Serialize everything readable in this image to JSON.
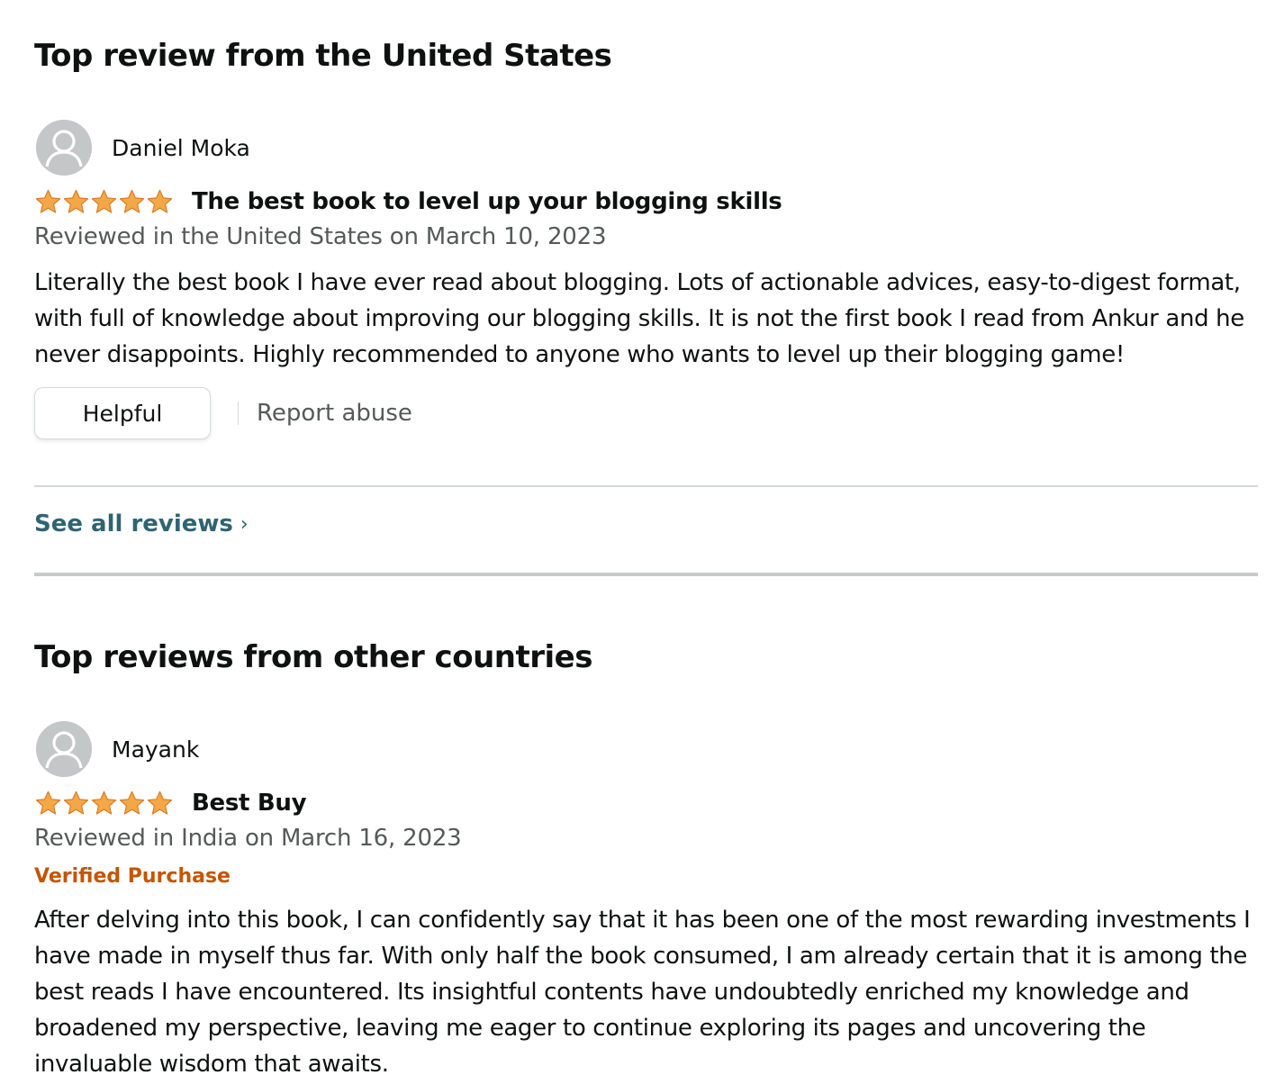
{
  "us_section": {
    "title": "Top review from the United States",
    "review": {
      "reviewer": "Daniel Moka",
      "rating": 5,
      "rating_max": 5,
      "title": "The best book to level up your blogging skills",
      "meta": "Reviewed in the United States on March 10, 2023",
      "body": "Literally the best book I have ever read about blogging. Lots of actionable advices, easy-to-digest format, with full of knowledge about improving our blogging skills. It is not the first book I read from Ankur and he never disappoints. Highly recommended to anyone who wants to level up their blogging game!",
      "helpful_label": "Helpful",
      "report_label": "Report abuse"
    },
    "see_all_label": "See all reviews"
  },
  "other_section": {
    "title": "Top reviews from other countries",
    "review": {
      "reviewer": "Mayank",
      "rating": 5,
      "rating_max": 5,
      "title": "Best Buy",
      "meta": "Reviewed in India on March 16, 2023",
      "badge": "Verified Purchase",
      "body": "After delving into this book, I can confidently say that it has been one of the most rewarding investments I have made in myself thus far. With only half the book consumed, I am already certain that it is among the best reads I have encountered. Its insightful contents have undoubtedly enriched my knowledge and broadened my perspective, leaving me eager to continue exploring its pages and uncovering the invaluable wisdom that awaits."
    }
  },
  "colors": {
    "star": "#f3a847",
    "star_stroke": "#de7921",
    "link": "#2f6473",
    "verified": "#c45500",
    "meta": "#565959",
    "divider": "#d5d9d9",
    "avatar_bg": "#c4c7c8"
  },
  "icons": {
    "avatar": "user-silhouette-icon",
    "star": "filled-star-icon",
    "chevron": "chevron-right-icon"
  }
}
